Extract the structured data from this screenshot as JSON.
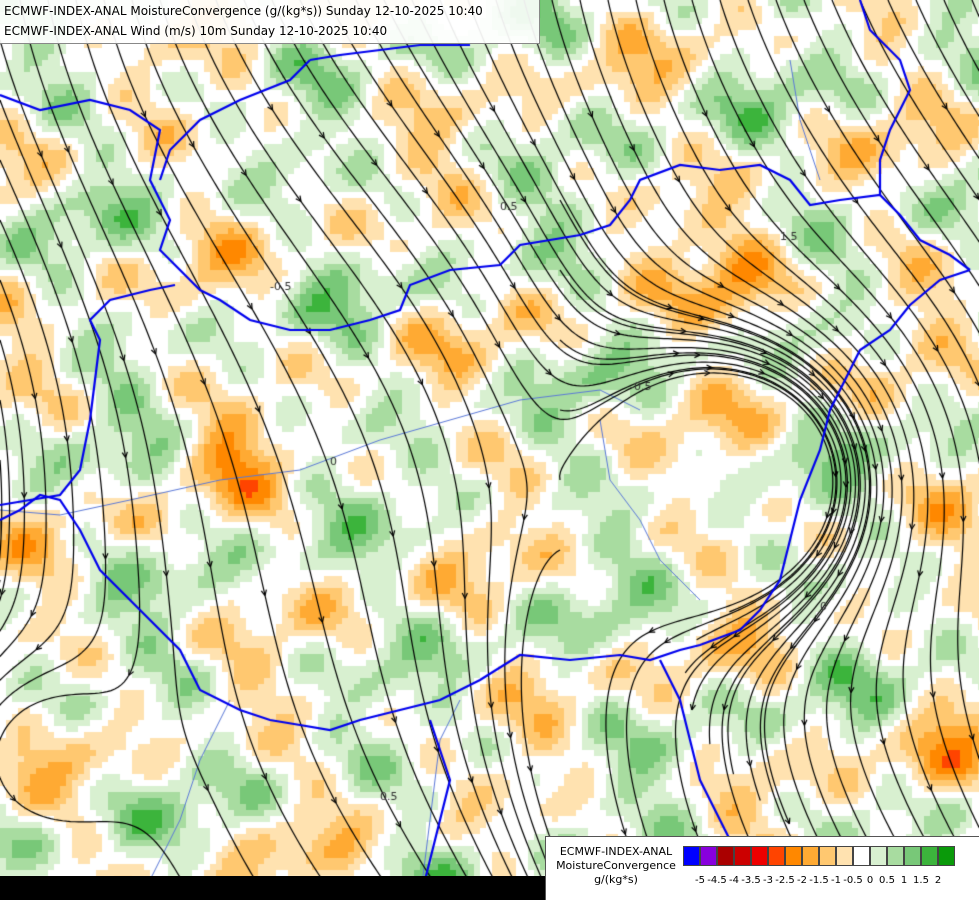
{
  "header": {
    "line1": "ECMWF-INDEX-ANAL MoistureConvergence (g/(kg*s)) Sunday 12-10-2025 10:40",
    "line2": "ECMWF-INDEX-ANAL Wind (m/s) 10m Sunday 12-10-2025 10:40"
  },
  "legend": {
    "line1": "ECMWF-INDEX-ANAL",
    "line2": "MoistureConvergence",
    "line3": "g/(kg*s)",
    "colors": [
      "#0000ff",
      "#8800dd",
      "#aa0000",
      "#cc0000",
      "#ee0000",
      "#ff4400",
      "#ff8800",
      "#ffaa33",
      "#ffc870",
      "#ffe2b0",
      "#ffffff",
      "#d8f0d0",
      "#a8dca0",
      "#78c878",
      "#3cb43c",
      "#0a9a0a"
    ],
    "ticks": [
      "-5",
      "-4.5",
      "-4",
      "-3.5",
      "-3",
      "-2.5",
      "-2",
      "-1.5",
      "-1",
      "-0.5",
      "0",
      "0.5",
      "1",
      "1.5",
      "2"
    ]
  },
  "map": {
    "colors": {
      "border": "#0000ee",
      "river": "#5a78d8",
      "streamline": "#000000",
      "contour_label": "#333333"
    },
    "contour_labels": [
      "-0.5",
      "0",
      "0.5",
      "1.5",
      "-0.5",
      "0",
      "0.5"
    ]
  }
}
